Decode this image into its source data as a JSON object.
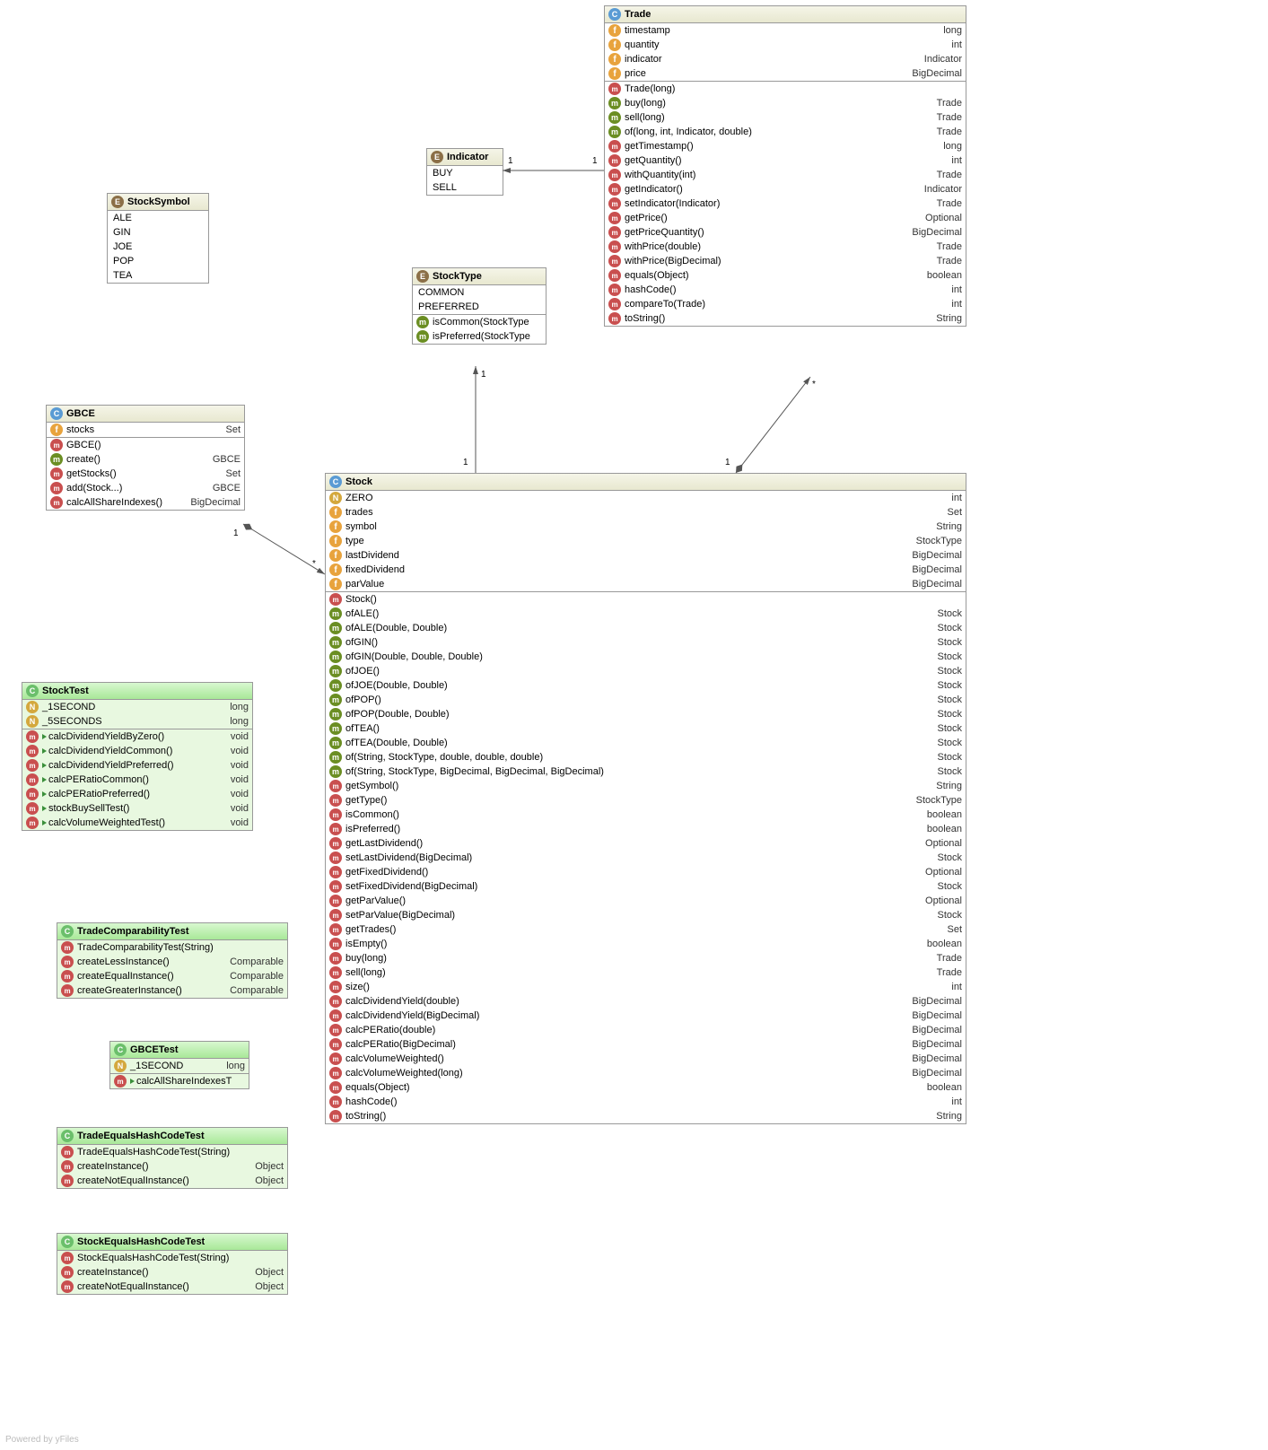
{
  "footer": "Powered by yFiles",
  "stockSymbol": {
    "name": "StockSymbol",
    "values": [
      "ALE",
      "GIN",
      "JOE",
      "POP",
      "TEA"
    ]
  },
  "indicator": {
    "name": "Indicator",
    "values": [
      "BUY",
      "SELL"
    ]
  },
  "stockType": {
    "name": "StockType",
    "methods": [
      {
        "name": "isCommon(StockType",
        "ret": ""
      },
      {
        "name": "isPreferred(StockType",
        "ret": ""
      }
    ],
    "values": [
      "COMMON",
      "PREFERRED"
    ]
  },
  "gbce": {
    "name": "GBCE",
    "fields": [
      {
        "name": "stocks",
        "type": "Set<Stock>"
      }
    ],
    "methods": [
      {
        "icon": "method",
        "name": "GBCE()",
        "type": ""
      },
      {
        "icon": "static",
        "name": "create()",
        "type": "GBCE"
      },
      {
        "icon": "method",
        "name": "getStocks()",
        "type": "Set<Stock>"
      },
      {
        "icon": "method",
        "name": "add(Stock...)",
        "type": "GBCE"
      },
      {
        "icon": "method",
        "name": "calcAllShareIndexes()",
        "type": "BigDecimal"
      }
    ]
  },
  "trade": {
    "name": "Trade",
    "fields": [
      {
        "name": "timestamp",
        "type": "long"
      },
      {
        "name": "quantity",
        "type": "int"
      },
      {
        "name": "indicator",
        "type": "Indicator"
      },
      {
        "name": "price",
        "type": "BigDecimal"
      }
    ],
    "methods": [
      {
        "icon": "method",
        "name": "Trade(long)",
        "type": ""
      },
      {
        "icon": "static",
        "name": "buy(long)",
        "type": "Trade"
      },
      {
        "icon": "static",
        "name": "sell(long)",
        "type": "Trade"
      },
      {
        "icon": "static",
        "name": "of(long, int, Indicator, double)",
        "type": "Trade"
      },
      {
        "icon": "method",
        "name": "getTimestamp()",
        "type": "long"
      },
      {
        "icon": "method",
        "name": "getQuantity()",
        "type": "int"
      },
      {
        "icon": "method",
        "name": "withQuantity(int)",
        "type": "Trade"
      },
      {
        "icon": "method",
        "name": "getIndicator()",
        "type": "Indicator"
      },
      {
        "icon": "method",
        "name": "setIndicator(Indicator)",
        "type": "Trade"
      },
      {
        "icon": "method",
        "name": "getPrice()",
        "type": "Optional<BigDecimal>"
      },
      {
        "icon": "method",
        "name": "getPriceQuantity()",
        "type": "BigDecimal"
      },
      {
        "icon": "method",
        "name": "withPrice(double)",
        "type": "Trade"
      },
      {
        "icon": "method",
        "name": "withPrice(BigDecimal)",
        "type": "Trade"
      },
      {
        "icon": "method",
        "name": "equals(Object)",
        "type": "boolean"
      },
      {
        "icon": "method",
        "name": "hashCode()",
        "type": "int"
      },
      {
        "icon": "method",
        "name": "compareTo(Trade)",
        "type": "int"
      },
      {
        "icon": "method",
        "name": "toString()",
        "type": "String"
      }
    ]
  },
  "stock": {
    "name": "Stock",
    "fields": [
      {
        "icon": "constant",
        "name": "ZERO",
        "type": "int"
      },
      {
        "icon": "field",
        "name": "trades",
        "type": "Set<Trade>"
      },
      {
        "icon": "field",
        "name": "symbol",
        "type": "String"
      },
      {
        "icon": "field",
        "name": "type",
        "type": "StockType"
      },
      {
        "icon": "field",
        "name": "lastDividend",
        "type": "BigDecimal"
      },
      {
        "icon": "field",
        "name": "fixedDividend",
        "type": "BigDecimal"
      },
      {
        "icon": "field",
        "name": "parValue",
        "type": "BigDecimal"
      }
    ],
    "methods": [
      {
        "icon": "method",
        "name": "Stock()",
        "type": ""
      },
      {
        "icon": "static",
        "name": "ofALE()",
        "type": "Stock"
      },
      {
        "icon": "static",
        "name": "ofALE(Double, Double)",
        "type": "Stock"
      },
      {
        "icon": "static",
        "name": "ofGIN()",
        "type": "Stock"
      },
      {
        "icon": "static",
        "name": "ofGIN(Double, Double, Double)",
        "type": "Stock"
      },
      {
        "icon": "static",
        "name": "ofJOE()",
        "type": "Stock"
      },
      {
        "icon": "static",
        "name": "ofJOE(Double, Double)",
        "type": "Stock"
      },
      {
        "icon": "static",
        "name": "ofPOP()",
        "type": "Stock"
      },
      {
        "icon": "static",
        "name": "ofPOP(Double, Double)",
        "type": "Stock"
      },
      {
        "icon": "static",
        "name": "ofTEA()",
        "type": "Stock"
      },
      {
        "icon": "static",
        "name": "ofTEA(Double, Double)",
        "type": "Stock"
      },
      {
        "icon": "static",
        "name": "of(String, StockType, double, double, double)",
        "type": "Stock"
      },
      {
        "icon": "static",
        "name": "of(String, StockType, BigDecimal, BigDecimal, BigDecimal)",
        "type": "Stock"
      },
      {
        "icon": "method",
        "name": "getSymbol()",
        "type": "String"
      },
      {
        "icon": "method",
        "name": "getType()",
        "type": "StockType"
      },
      {
        "icon": "method",
        "name": "isCommon()",
        "type": "boolean"
      },
      {
        "icon": "method",
        "name": "isPreferred()",
        "type": "boolean"
      },
      {
        "icon": "method",
        "name": "getLastDividend()",
        "type": "Optional<BigDecimal>"
      },
      {
        "icon": "method",
        "name": "setLastDividend(BigDecimal)",
        "type": "Stock"
      },
      {
        "icon": "method",
        "name": "getFixedDividend()",
        "type": "Optional<BigDecimal>"
      },
      {
        "icon": "method",
        "name": "setFixedDividend(BigDecimal)",
        "type": "Stock"
      },
      {
        "icon": "method",
        "name": "getParValue()",
        "type": "Optional<BigDecimal>"
      },
      {
        "icon": "method",
        "name": "setParValue(BigDecimal)",
        "type": "Stock"
      },
      {
        "icon": "method",
        "name": "getTrades()",
        "type": "Set<Trade>"
      },
      {
        "icon": "method",
        "name": "isEmpty()",
        "type": "boolean"
      },
      {
        "icon": "method",
        "name": "buy(long)",
        "type": "Trade"
      },
      {
        "icon": "method",
        "name": "sell(long)",
        "type": "Trade"
      },
      {
        "icon": "method",
        "name": "size()",
        "type": "int"
      },
      {
        "icon": "method",
        "name": "calcDividendYield(double)",
        "type": "BigDecimal"
      },
      {
        "icon": "method",
        "name": "calcDividendYield(BigDecimal)",
        "type": "BigDecimal"
      },
      {
        "icon": "method",
        "name": "calcPERatio(double)",
        "type": "BigDecimal"
      },
      {
        "icon": "method",
        "name": "calcPERatio(BigDecimal)",
        "type": "BigDecimal"
      },
      {
        "icon": "method",
        "name": "calcVolumeWeighted()",
        "type": "BigDecimal"
      },
      {
        "icon": "method",
        "name": "calcVolumeWeighted(long)",
        "type": "BigDecimal"
      },
      {
        "icon": "method",
        "name": "equals(Object)",
        "type": "boolean"
      },
      {
        "icon": "method",
        "name": "hashCode()",
        "type": "int"
      },
      {
        "icon": "method",
        "name": "toString()",
        "type": "String"
      }
    ]
  },
  "stockTest": {
    "name": "StockTest",
    "fields": [
      {
        "name": "_1SECOND",
        "type": "long"
      },
      {
        "name": "_5SECONDS",
        "type": "long"
      }
    ],
    "methods": [
      {
        "name": "calcDividendYieldByZero()",
        "type": "void"
      },
      {
        "name": "calcDividendYieldCommon()",
        "type": "void"
      },
      {
        "name": "calcDividendYieldPreferred()",
        "type": "void"
      },
      {
        "name": "calcPERatioCommon()",
        "type": "void"
      },
      {
        "name": "calcPERatioPreferred()",
        "type": "void"
      },
      {
        "name": "stockBuySellTest()",
        "type": "void"
      },
      {
        "name": "calcVolumeWeightedTest()",
        "type": "void"
      }
    ]
  },
  "tradeComparabilityTest": {
    "name": "TradeComparabilityTest",
    "methods": [
      {
        "icon": "method",
        "name": "TradeComparabilityTest(String)",
        "type": ""
      },
      {
        "icon": "method",
        "name": "createLessInstance()",
        "type": "Comparable"
      },
      {
        "icon": "method",
        "name": "createEqualInstance()",
        "type": "Comparable"
      },
      {
        "icon": "method",
        "name": "createGreaterInstance()",
        "type": "Comparable"
      }
    ]
  },
  "gbceTest": {
    "name": "GBCETest",
    "fields": [
      {
        "name": "_1SECOND",
        "type": "long"
      }
    ],
    "methods": [
      {
        "name": "calcAllShareIndexesT",
        "type": ""
      }
    ]
  },
  "tradeEqHash": {
    "name": "TradeEqualsHashCodeTest",
    "methods": [
      {
        "icon": "method",
        "name": "TradeEqualsHashCodeTest(String)",
        "type": ""
      },
      {
        "icon": "method",
        "name": "createInstance()",
        "type": "Object"
      },
      {
        "icon": "method",
        "name": "createNotEqualInstance()",
        "type": "Object"
      }
    ]
  },
  "stockEqHash": {
    "name": "StockEqualsHashCodeTest",
    "methods": [
      {
        "icon": "method",
        "name": "StockEqualsHashCodeTest(String)",
        "type": ""
      },
      {
        "icon": "method",
        "name": "createInstance()",
        "type": "Object"
      },
      {
        "icon": "method",
        "name": "createNotEqualInstance()",
        "type": "Object"
      }
    ]
  },
  "cardinality": {
    "one": "1",
    "star": "*"
  }
}
